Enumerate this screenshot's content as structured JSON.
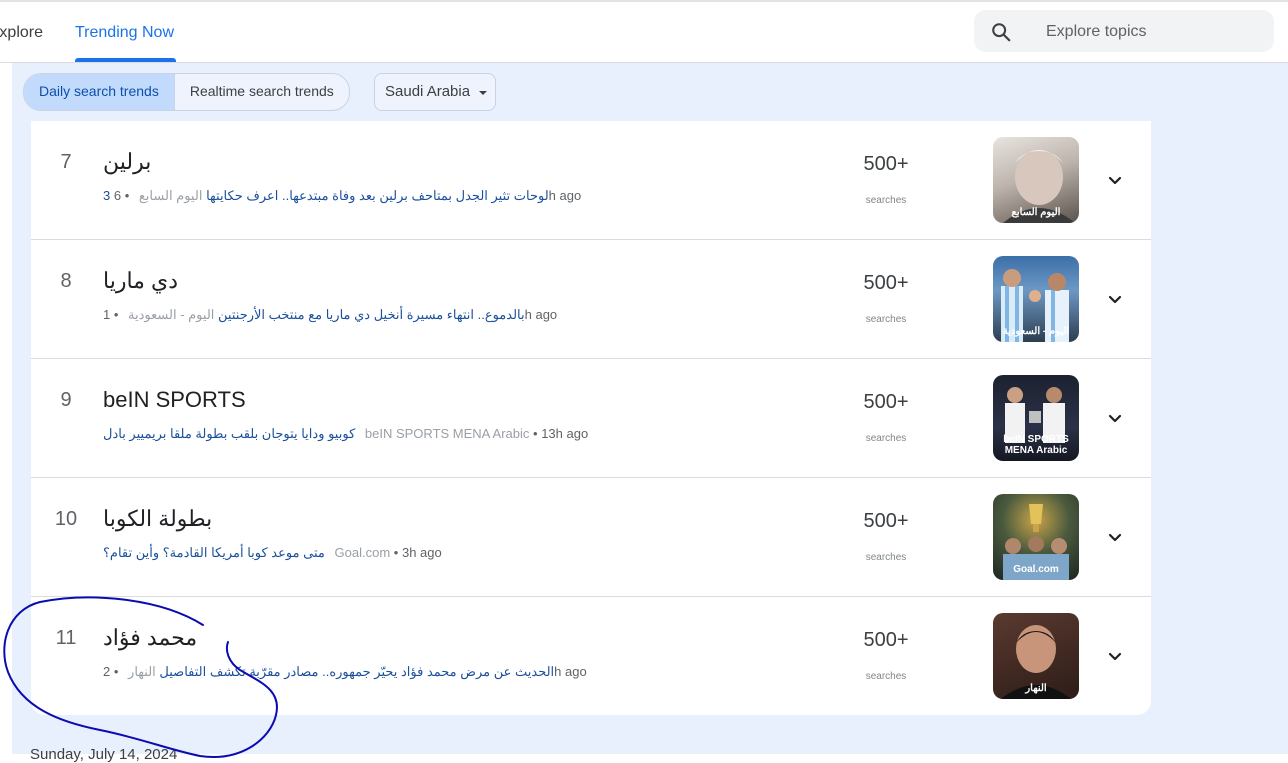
{
  "nav": {
    "explore_label": "Explore",
    "trending_label": "Trending Now"
  },
  "search": {
    "placeholder": "Explore topics"
  },
  "filters": {
    "daily_label": "Daily search trends",
    "realtime_label": "Realtime search trends",
    "geo_label": "Saudi Arabia"
  },
  "trends": [
    {
      "rank": "7",
      "title": "برلين",
      "article": "3 لوحات تثير الجدل بمتاحف برلين بعد وفاة مبتدعها.. اعرف حكايتها",
      "source": "اليوم السابع",
      "time": "6h ago",
      "count": "500+",
      "count_label": "searches",
      "thumb_caption": "اليوم السابع"
    },
    {
      "rank": "8",
      "title": "دي ماريا",
      "article": "بالدموع.. انتهاء مسيرة أنخيل دي ماريا مع منتخب الأرجنتين",
      "source": "اليوم - السعودية",
      "time": "1h ago",
      "count": "500+",
      "count_label": "searches",
      "thumb_caption": "اليوم - السعودية"
    },
    {
      "rank": "9",
      "title": "beIN SPORTS",
      "article": "كوبيو ودايا يتوجان بلقب بطولة ملقا بريميير بادل",
      "source": "beIN SPORTS MENA Arabic",
      "time": "13h ago",
      "count": "500+",
      "count_label": "searches",
      "thumb_caption": "beIN SPORTS MENA Arabic"
    },
    {
      "rank": "10",
      "title": "بطولة الكوبا",
      "article": "متى موعد كوبا أمريكا القادمة؟ وأين تقام؟",
      "source": "Goal.com",
      "time": "3h ago",
      "count": "500+",
      "count_label": "searches",
      "thumb_caption": "Goal.com"
    },
    {
      "rank": "11",
      "title": "محمد فؤاد",
      "article": "الحديث عن مرض محمد فؤاد يحيّر جمهوره.. مصادر مقرّبة تكشف التفاصيل",
      "source": "النهار",
      "time": "2h ago",
      "count": "500+",
      "count_label": "searches",
      "thumb_caption": "النهار"
    }
  ],
  "next_date": "Sunday, July 14, 2024",
  "colors": {
    "accent": "#1a73e8",
    "background": "#e8f0fe",
    "annotation_ink": "#0b0bb0"
  }
}
